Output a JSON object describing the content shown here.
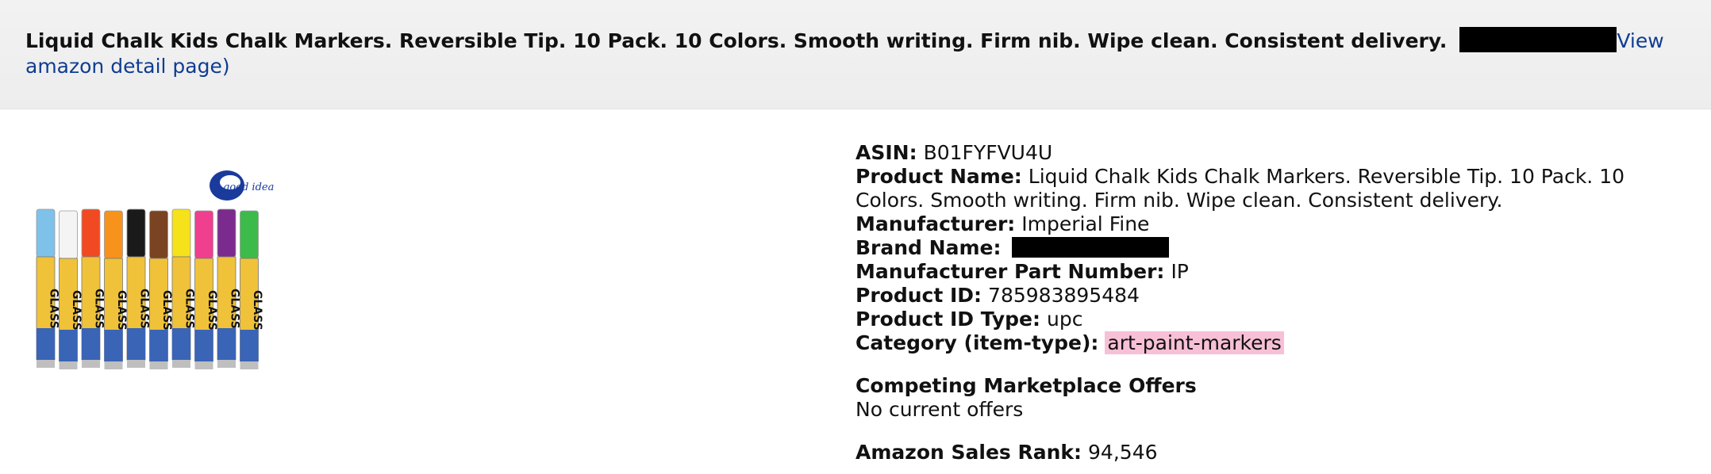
{
  "header": {
    "title": "Liquid Chalk Kids Chalk Markers. Reversible Tip. 10 Pack. 10 Colors. Smooth writing. Firm nib. Wipe clean. Consistent delivery.",
    "link_text": "View amazon detail page)"
  },
  "image": {
    "logo_text": "good idea",
    "marker_text": "GLASS",
    "marker_colors": [
      "#7ec2ea",
      "#f4f4f4",
      "#f14a22",
      "#f7921c",
      "#1a1a1a",
      "#7a4322",
      "#f5e21a",
      "#ef3f8e",
      "#7b2b8e",
      "#3dbb4a"
    ]
  },
  "details": {
    "asin_label": "ASIN:",
    "asin_value": "B01FYFVU4U",
    "product_name_label": "Product Name:",
    "product_name_value": "Liquid Chalk Kids Chalk Markers. Reversible Tip. 10 Pack. 10 Colors. Smooth writing. Firm nib. Wipe clean. Consistent delivery.",
    "manufacturer_label": "Manufacturer:",
    "manufacturer_value": "Imperial Fine",
    "brand_label": "Brand Name:",
    "mpn_label": "Manufacturer Part Number:",
    "mpn_value": "IP",
    "product_id_label": "Product ID:",
    "product_id_value": "785983895484",
    "product_id_type_label": "Product ID Type:",
    "product_id_type_value": "upc",
    "category_label": "Category (item-type):",
    "category_value": "art-paint-markers"
  },
  "offers": {
    "title": "Competing Marketplace Offers",
    "value": "No current offers"
  },
  "rank": {
    "label": "Amazon Sales Rank:",
    "value": "94,546"
  },
  "colors": {
    "header_bg": "#efefef",
    "link": "#0f3d91",
    "category_highlight": "#f7c0d6"
  }
}
